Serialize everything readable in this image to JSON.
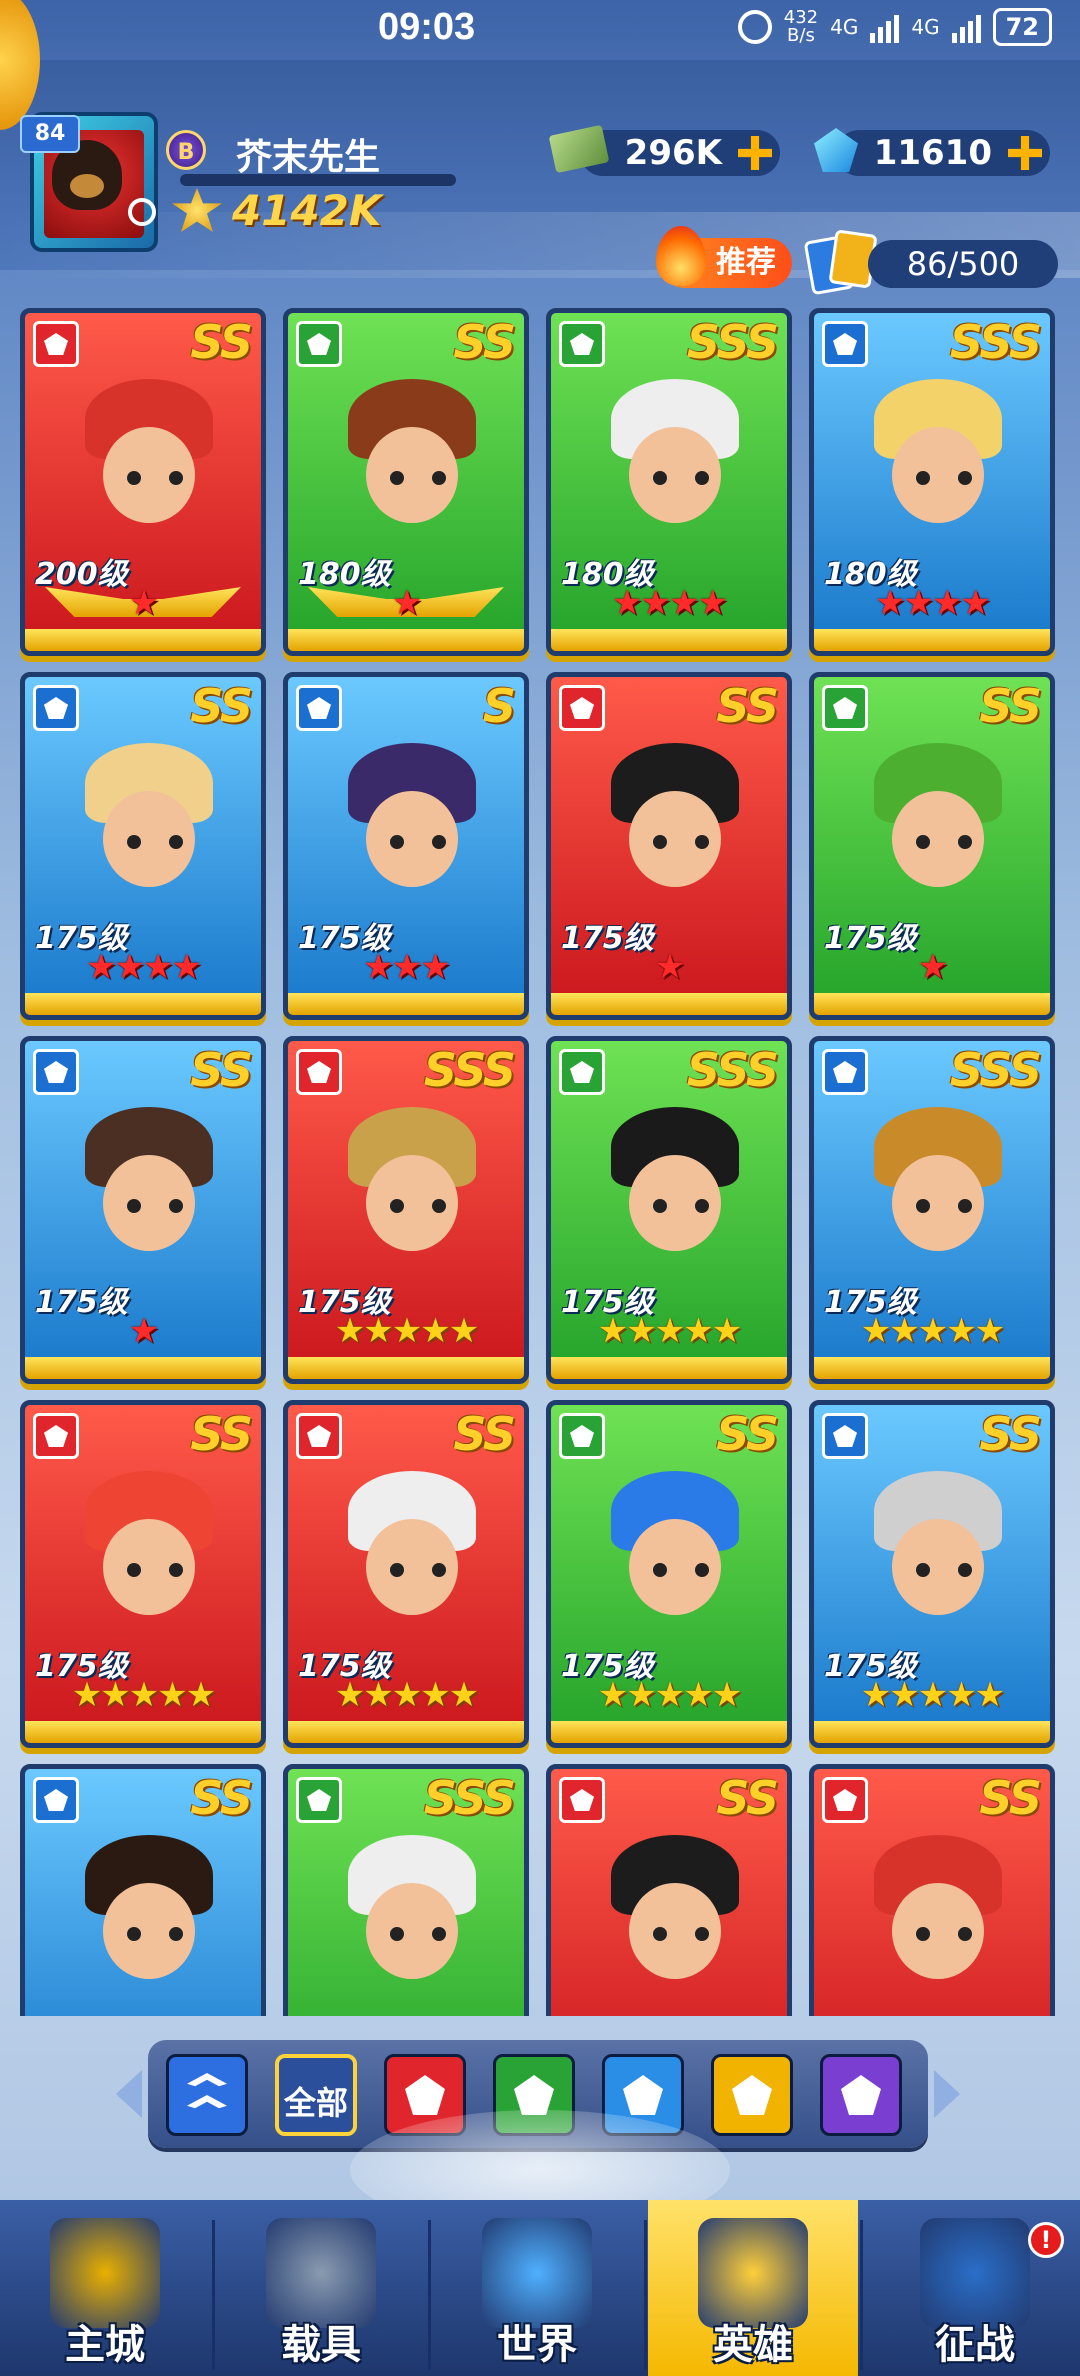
{
  "status_bar": {
    "time": "09:03",
    "net_speed_value": "432",
    "net_speed_unit": "B/s",
    "sig1": "4G",
    "sig2": "4G",
    "battery": "72"
  },
  "player": {
    "level": "84",
    "rank": "B",
    "name": "芥末先生",
    "power": "4142K"
  },
  "resources": {
    "cash": "296K",
    "gems": "11610"
  },
  "recommend_label": "推荐",
  "hero_count": "86/500",
  "heroes": [
    {
      "faction": "red",
      "grade": "SS",
      "level": "200级",
      "stars": "★",
      "star_color": "red"
    },
    {
      "faction": "green",
      "grade": "SS",
      "level": "180级",
      "stars": "★",
      "star_color": "red"
    },
    {
      "faction": "green",
      "grade": "SSS",
      "level": "180级",
      "stars": "★★★★",
      "star_color": "red"
    },
    {
      "faction": "blue",
      "grade": "SSS",
      "level": "180级",
      "stars": "★★★★",
      "star_color": "red"
    },
    {
      "faction": "blue",
      "grade": "SS",
      "level": "175级",
      "stars": "★★★★",
      "star_color": "red"
    },
    {
      "faction": "blue",
      "grade": "S",
      "level": "175级",
      "stars": "★★★",
      "star_color": "red"
    },
    {
      "faction": "red",
      "grade": "SS",
      "level": "175级",
      "stars": "★",
      "star_color": "red"
    },
    {
      "faction": "green",
      "grade": "SS",
      "level": "175级",
      "stars": "★",
      "star_color": "red"
    },
    {
      "faction": "blue",
      "grade": "SS",
      "level": "175级",
      "stars": "★",
      "star_color": "red"
    },
    {
      "faction": "red",
      "grade": "SSS",
      "level": "175级",
      "stars": "★★★★★",
      "star_color": "gold"
    },
    {
      "faction": "green",
      "grade": "SSS",
      "level": "175级",
      "stars": "★★★★★",
      "star_color": "gold"
    },
    {
      "faction": "blue",
      "grade": "SSS",
      "level": "175级",
      "stars": "★★★★★",
      "star_color": "gold"
    },
    {
      "faction": "red",
      "grade": "SS",
      "level": "175级",
      "stars": "★★★★★",
      "star_color": "gold"
    },
    {
      "faction": "red",
      "grade": "SS",
      "level": "175级",
      "stars": "★★★★★",
      "star_color": "gold"
    },
    {
      "faction": "green",
      "grade": "SS",
      "level": "175级",
      "stars": "★★★★★",
      "star_color": "gold"
    },
    {
      "faction": "blue",
      "grade": "SS",
      "level": "175级",
      "stars": "★★★★★",
      "star_color": "gold"
    },
    {
      "faction": "blue",
      "grade": "SS",
      "level": "",
      "stars": "",
      "star_color": "gold"
    },
    {
      "faction": "green",
      "grade": "SSS",
      "level": "",
      "stars": "",
      "star_color": "gold"
    },
    {
      "faction": "red",
      "grade": "SS",
      "level": "",
      "stars": "",
      "star_color": "gold"
    },
    {
      "faction": "red",
      "grade": "SS",
      "level": "",
      "stars": "",
      "star_color": "gold"
    }
  ],
  "filters": [
    {
      "name": "rank-up-filter",
      "label": "",
      "color": "#2d6fe0",
      "active": false
    },
    {
      "name": "all-filter",
      "label": "全部",
      "color": "#2b4f9a",
      "active": true
    },
    {
      "name": "red-faction-filter",
      "label": "",
      "color": "#e0262c",
      "active": false
    },
    {
      "name": "green-faction-filter",
      "label": "",
      "color": "#2aa336",
      "active": false
    },
    {
      "name": "blue-faction-filter",
      "label": "",
      "color": "#2a8de6",
      "active": false
    },
    {
      "name": "gold-faction-filter",
      "label": "",
      "color": "#f2b200",
      "active": false
    },
    {
      "name": "purple-faction-filter",
      "label": "",
      "color": "#7a3fd1",
      "active": false
    }
  ],
  "nav": [
    {
      "label": "主城",
      "active": false
    },
    {
      "label": "载具",
      "active": false
    },
    {
      "label": "世界",
      "active": false
    },
    {
      "label": "英雄",
      "active": true
    },
    {
      "label": "征战",
      "active": false
    }
  ],
  "nav_alert": "!"
}
